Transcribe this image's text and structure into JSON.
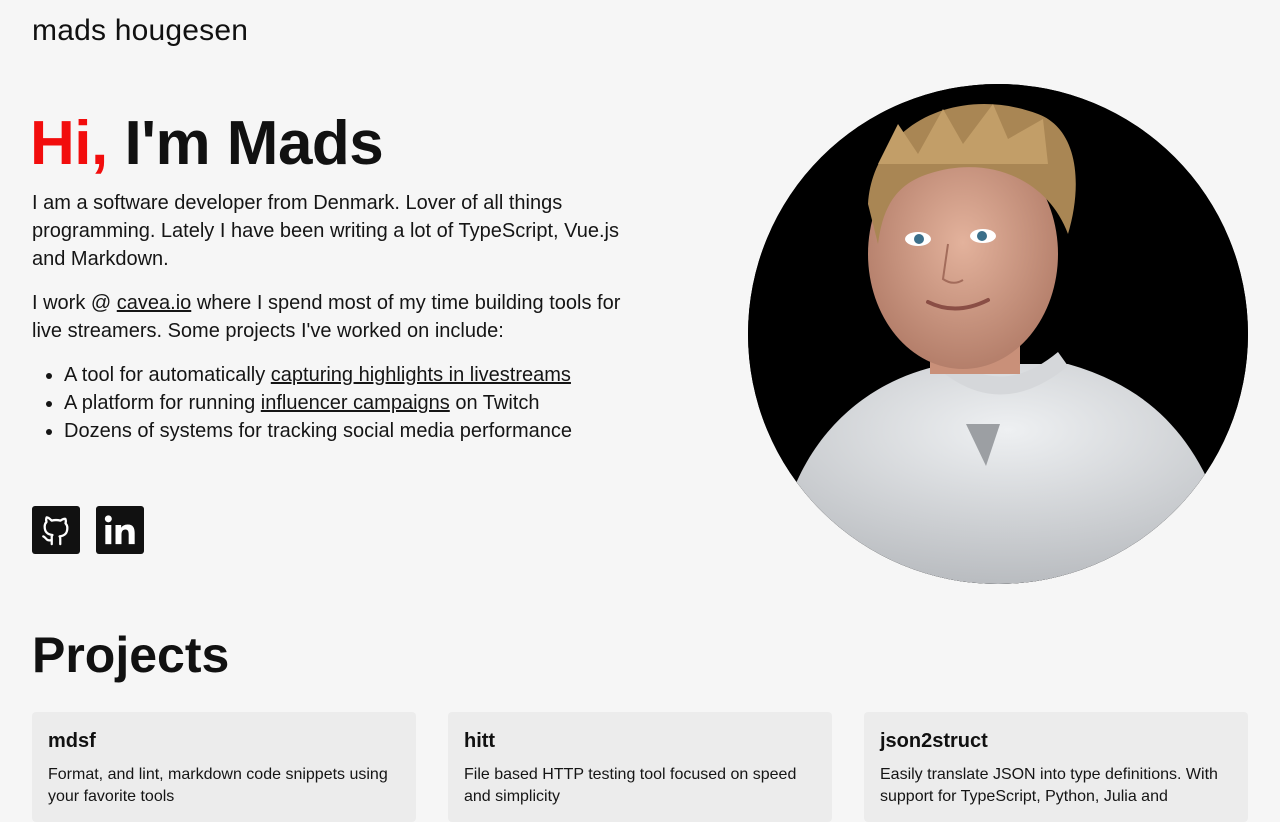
{
  "header": {
    "site_name": "mads hougesen"
  },
  "hero": {
    "greeting": "Hi,",
    "name": "I'm Mads",
    "intro_paragraph": "I am a software developer from Denmark. Lover of all things programming. Lately I have been writing a lot of TypeScript, Vue.js and Markdown.",
    "work_prefix": "I work @ ",
    "work_link": "cavea.io",
    "work_suffix": " where I spend most of my time building tools for live streamers. Some projects I've worked on include:",
    "list": [
      {
        "prefix": "A tool for automatically ",
        "link": "capturing highlights in livestreams",
        "suffix": ""
      },
      {
        "prefix": "A platform for running ",
        "link": "influencer campaigns",
        "suffix": " on Twitch"
      },
      {
        "prefix": "Dozens of systems for tracking social media performance",
        "link": "",
        "suffix": ""
      }
    ],
    "socials": [
      {
        "icon": "github-icon"
      },
      {
        "icon": "linkedin-icon"
      }
    ]
  },
  "projects": {
    "title": "Projects",
    "items": [
      {
        "name": "mdsf",
        "description": "Format, and lint, markdown code snippets using your favorite tools"
      },
      {
        "name": "hitt",
        "description": "File based HTTP testing tool focused on speed and simplicity"
      },
      {
        "name": "json2struct",
        "description": "Easily translate JSON into type definitions. With support for TypeScript, Python, Julia and"
      }
    ]
  },
  "colors": {
    "accent": "#f20d0d",
    "background": "#f6f6f6",
    "card": "#ececec"
  }
}
